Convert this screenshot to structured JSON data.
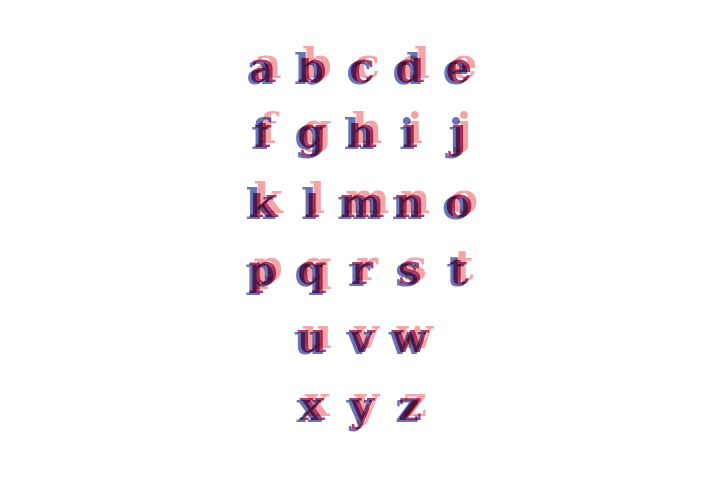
{
  "colors": {
    "background": "#ffffff",
    "pink": "#f4a3a8",
    "blue": "#6b73b8",
    "rose": "#b03d6c"
  },
  "rows": [
    [
      "a",
      "b",
      "c",
      "d",
      "e"
    ],
    [
      "f",
      "g",
      "h",
      "i",
      "j"
    ],
    [
      "k",
      "l",
      "m",
      "n",
      "o"
    ],
    [
      "p",
      "q",
      "r",
      "s",
      "t"
    ],
    [
      "u",
      "v",
      "w"
    ],
    [
      "x",
      "y",
      "z"
    ]
  ]
}
